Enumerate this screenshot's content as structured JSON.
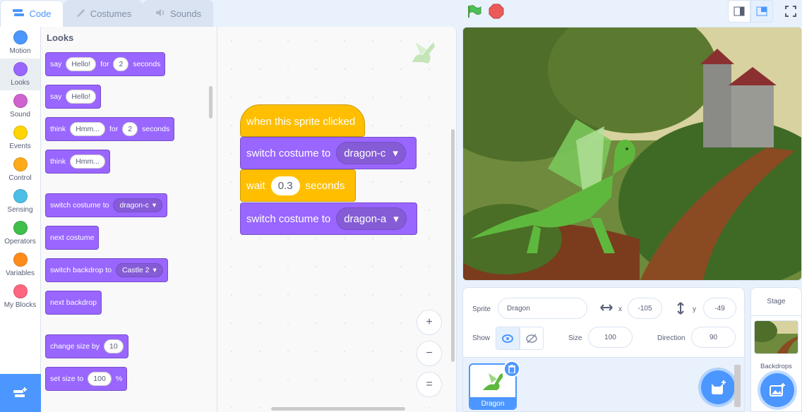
{
  "tabs": [
    {
      "label": "Code",
      "icon": "code-icon"
    },
    {
      "label": "Costumes",
      "icon": "brush-icon"
    },
    {
      "label": "Sounds",
      "icon": "speaker-icon"
    }
  ],
  "categories": [
    {
      "label": "Motion",
      "color": "#4c97ff"
    },
    {
      "label": "Looks",
      "color": "#9966ff"
    },
    {
      "label": "Sound",
      "color": "#cf63cf"
    },
    {
      "label": "Events",
      "color": "#ffd500"
    },
    {
      "label": "Control",
      "color": "#ffab19"
    },
    {
      "label": "Sensing",
      "color": "#4cbfe6"
    },
    {
      "label": "Operators",
      "color": "#40bf4a"
    },
    {
      "label": "Variables",
      "color": "#ff8c1a"
    },
    {
      "label": "My Blocks",
      "color": "#ff6680"
    }
  ],
  "palette": {
    "title": "Looks",
    "say_for": {
      "a": "say",
      "val": "Hello!",
      "b": "for",
      "secs": "2",
      "c": "seconds"
    },
    "say": {
      "a": "say",
      "val": "Hello!"
    },
    "think_for": {
      "a": "think",
      "val": "Hmm...",
      "b": "for",
      "secs": "2",
      "c": "seconds"
    },
    "think": {
      "a": "think",
      "val": "Hmm..."
    },
    "switch_costume": {
      "a": "switch costume to",
      "val": "dragon-c"
    },
    "next_costume": "next costume",
    "switch_backdrop": {
      "a": "switch backdrop to",
      "val": "Castle 2"
    },
    "next_backdrop": "next backdrop",
    "change_size": {
      "a": "change size by",
      "val": "10"
    },
    "set_size": {
      "a": "set size to",
      "val": "100",
      "b": "%"
    }
  },
  "script": {
    "hat": "when this sprite clicked",
    "b1": {
      "a": "switch costume to",
      "val": "dragon-c"
    },
    "b2": {
      "a": "wait",
      "val": "0.3",
      "b": "seconds"
    },
    "b3": {
      "a": "switch costume to",
      "val": "dragon-a"
    }
  },
  "zoom": {
    "in": "+",
    "out": "−",
    "reset": "="
  },
  "sprite_info": {
    "sprite_label": "Sprite",
    "sprite_name": "Dragon",
    "x_label": "x",
    "x": "-105",
    "y_label": "y",
    "y": "-49",
    "show_label": "Show",
    "size_label": "Size",
    "size": "100",
    "direction_label": "Direction",
    "direction": "90"
  },
  "sprite_list": [
    {
      "name": "Dragon"
    }
  ],
  "stage_panel": {
    "title": "Stage",
    "backdrops_label": "Backdrops"
  },
  "colors": {
    "accent": "#4c97ff",
    "looks": "#9966ff",
    "control": "#ffbf00"
  }
}
